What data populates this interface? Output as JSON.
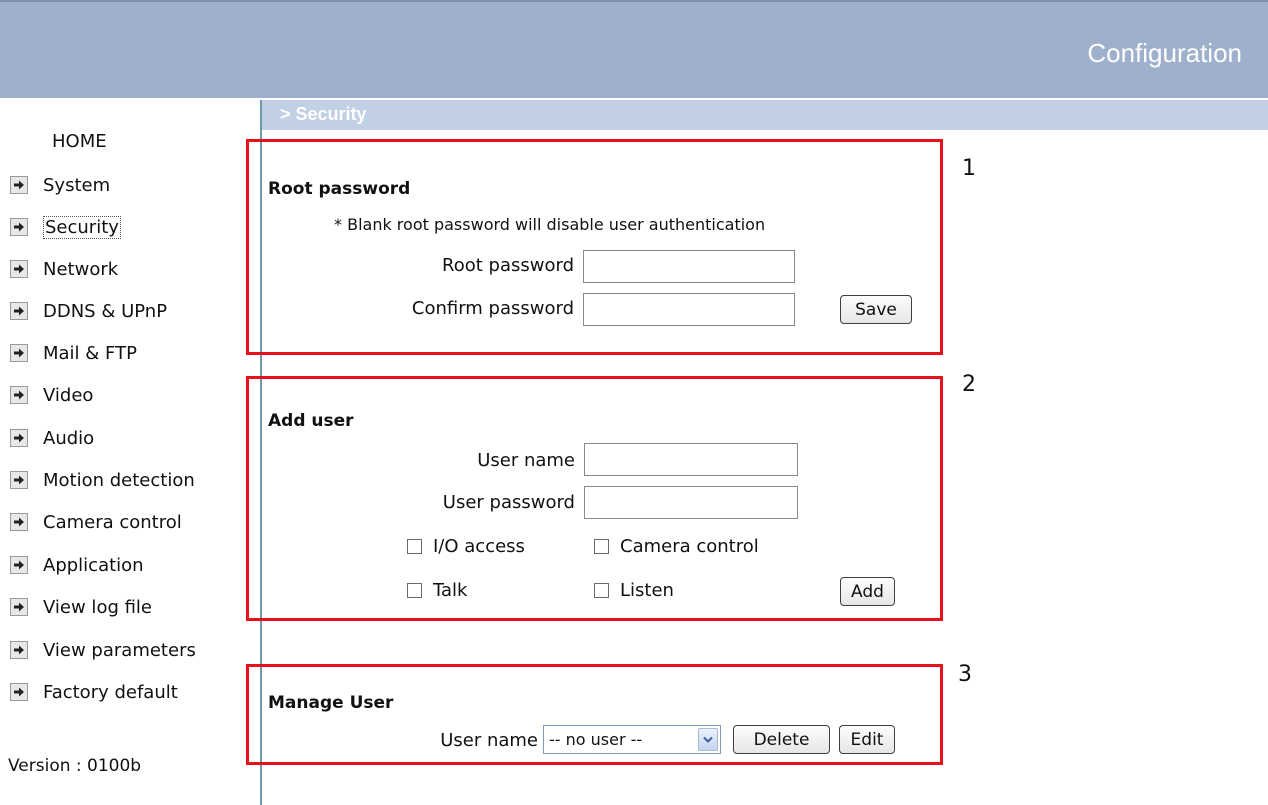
{
  "header": {
    "title": "Configuration",
    "breadcrumb": "> Security"
  },
  "sidebar": {
    "home": "HOME",
    "items": [
      {
        "label": "System"
      },
      {
        "label": "Security"
      },
      {
        "label": "Network"
      },
      {
        "label": "DDNS & UPnP"
      },
      {
        "label": "Mail & FTP"
      },
      {
        "label": "Video"
      },
      {
        "label": "Audio"
      },
      {
        "label": "Motion detection"
      },
      {
        "label": "Camera control"
      },
      {
        "label": "Application"
      },
      {
        "label": "View log file"
      },
      {
        "label": "View parameters"
      },
      {
        "label": "Factory default"
      }
    ],
    "version": "Version : 0100b"
  },
  "root_password": {
    "heading": "Root password",
    "note": "* Blank root password will disable user authentication",
    "root_label": "Root password",
    "root_value": "",
    "confirm_label": "Confirm password",
    "confirm_value": "",
    "save_label": "Save"
  },
  "add_user": {
    "heading": "Add user",
    "username_label": "User name",
    "username_value": "",
    "password_label": "User password",
    "password_value": "",
    "io_access_label": "I/O access",
    "io_access_checked": false,
    "camera_control_label": "Camera control",
    "camera_control_checked": false,
    "talk_label": "Talk",
    "talk_checked": false,
    "listen_label": "Listen",
    "listen_checked": false,
    "add_label": "Add"
  },
  "manage_user": {
    "heading": "Manage User",
    "username_label": "User name",
    "selected": "-- no user --",
    "delete_label": "Delete",
    "edit_label": "Edit"
  },
  "annotations": [
    "1",
    "2",
    "3"
  ],
  "colors": {
    "header_bg": "#9fb0cc",
    "subheader_bg": "#c1d0e4",
    "highlight_box": "#e8101a"
  },
  "icons": {
    "nav_bullet": "arrow-right-icon",
    "dropdown": "chevron-down-icon"
  }
}
